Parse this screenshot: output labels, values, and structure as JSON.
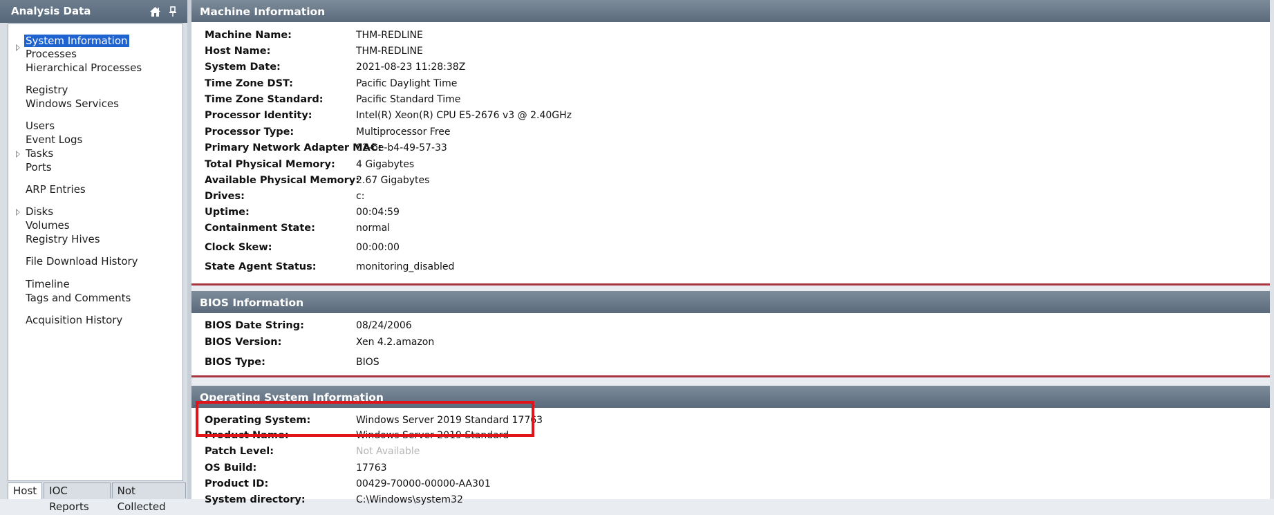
{
  "left_panel": {
    "title": "Analysis Data",
    "icons": [
      "home-icon",
      "pin-icon"
    ],
    "tree": [
      {
        "label": "System Information",
        "selected": true,
        "expandable": false
      },
      {
        "label": "Processes",
        "expandable": true
      },
      {
        "label": "Hierarchical Processes",
        "expandable": false
      },
      {
        "label": "Registry",
        "expandable": false
      },
      {
        "label": "Windows Services",
        "expandable": false
      },
      {
        "label": "Users",
        "expandable": false
      },
      {
        "label": "Event Logs",
        "expandable": false
      },
      {
        "label": "Tasks",
        "expandable": true
      },
      {
        "label": "Ports",
        "expandable": false
      },
      {
        "label": "ARP Entries",
        "expandable": false
      },
      {
        "label": "Disks",
        "expandable": true
      },
      {
        "label": "Volumes",
        "expandable": false
      },
      {
        "label": "Registry Hives",
        "expandable": false
      },
      {
        "label": "File Download History",
        "expandable": false
      },
      {
        "label": "Timeline",
        "expandable": false
      },
      {
        "label": "Tags and Comments",
        "expandable": false
      },
      {
        "label": "Acquisition History",
        "expandable": false
      }
    ],
    "tabs": [
      {
        "label": "Host",
        "active": true
      },
      {
        "label": "IOC Reports",
        "active": false
      },
      {
        "label": "Not Collected",
        "active": false
      }
    ]
  },
  "machine_info": {
    "title": "Machine Information",
    "rows": [
      {
        "key": "Machine Name:",
        "value": "THM-REDLINE"
      },
      {
        "key": "Host Name:",
        "value": "THM-REDLINE"
      },
      {
        "key": "System Date:",
        "value": "2021-08-23 11:28:38Z"
      },
      {
        "key": "Time Zone DST:",
        "value": "Pacific Daylight Time"
      },
      {
        "key": "Time Zone Standard:",
        "value": "Pacific Standard Time"
      },
      {
        "key": "Processor Identity:",
        "value": "Intel(R) Xeon(R) CPU E5-2676 v3 @ 2.40GHz"
      },
      {
        "key": "Processor Type:",
        "value": "Multiprocessor Free"
      },
      {
        "key": "Primary Network Adapter MAC:",
        "value": "02-be-b4-49-57-33"
      },
      {
        "key": "Total Physical Memory:",
        "value": "4 Gigabytes"
      },
      {
        "key": "Available Physical Memory:",
        "value": "2.67 Gigabytes"
      },
      {
        "key": "Drives:",
        "value": "c:"
      },
      {
        "key": "Uptime:",
        "value": "00:04:59"
      },
      {
        "key": "Containment State:",
        "value": "normal"
      },
      {
        "key": "Clock Skew:",
        "value": "00:00:00"
      },
      {
        "key": "State Agent Status:",
        "value": "monitoring_disabled"
      }
    ]
  },
  "bios_info": {
    "title": "BIOS Information",
    "rows": [
      {
        "key": "BIOS Date String:",
        "value": "08/24/2006"
      },
      {
        "key": "BIOS Version:",
        "value": "Xen 4.2.amazon"
      },
      {
        "key": "BIOS Type:",
        "value": "BIOS"
      }
    ]
  },
  "os_info": {
    "title": "Operating System Information",
    "rows": [
      {
        "key": "Operating System:",
        "value": "Windows Server 2019 Standard 17763"
      },
      {
        "key": "Product Name:",
        "value": "Windows Server 2019 Standard"
      },
      {
        "key": "Patch Level:",
        "value": "Not Available",
        "muted": true
      },
      {
        "key": "OS Build:",
        "value": "17763"
      },
      {
        "key": "Product ID:",
        "value": "00429-70000-00000-AA301"
      },
      {
        "key": "System directory:",
        "value": "C:\\Windows\\system32"
      }
    ]
  },
  "colors": {
    "header_gradient_top": "#7d8c9b",
    "header_gradient_bottom": "#5a6a7b",
    "section_separator": "#a9343f",
    "selection": "#1e63d0",
    "highlight_box": "#e0141b"
  }
}
